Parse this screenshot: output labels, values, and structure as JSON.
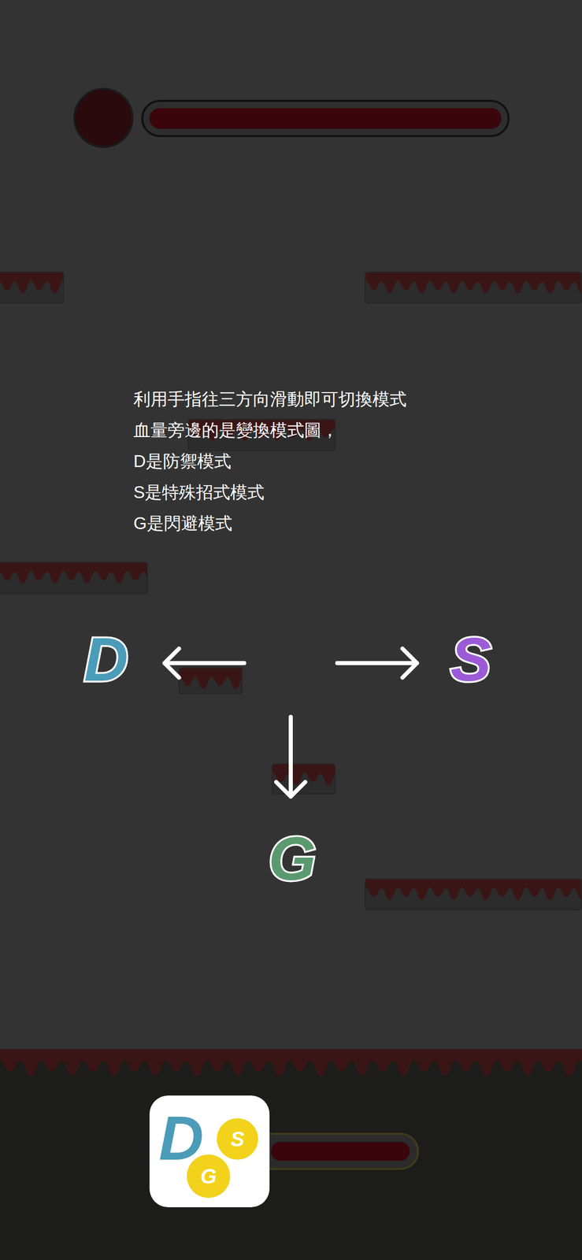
{
  "boss": {
    "health_level": 1
  },
  "tutorial": {
    "lines": [
      "利用手指往三方向滑動即可切換模式",
      "血量旁邊的是變換模式圖，",
      "D是防禦模式",
      "S是特殊招式模式",
      "G是閃避模式"
    ]
  },
  "modes": [
    {
      "letter": "D",
      "kind": "left",
      "color": "#4a9cb8"
    },
    {
      "letter": "S",
      "kind": "right",
      "color": "#9b5bd6"
    },
    {
      "letter": "G",
      "kind": "down",
      "color": "#5a9a6e"
    }
  ],
  "player": {
    "badge": {
      "main": "D",
      "small": [
        "S",
        "G"
      ],
      "main_color": "#4a9cb8",
      "small_color": "#f2d21b"
    },
    "health_level": 1
  }
}
